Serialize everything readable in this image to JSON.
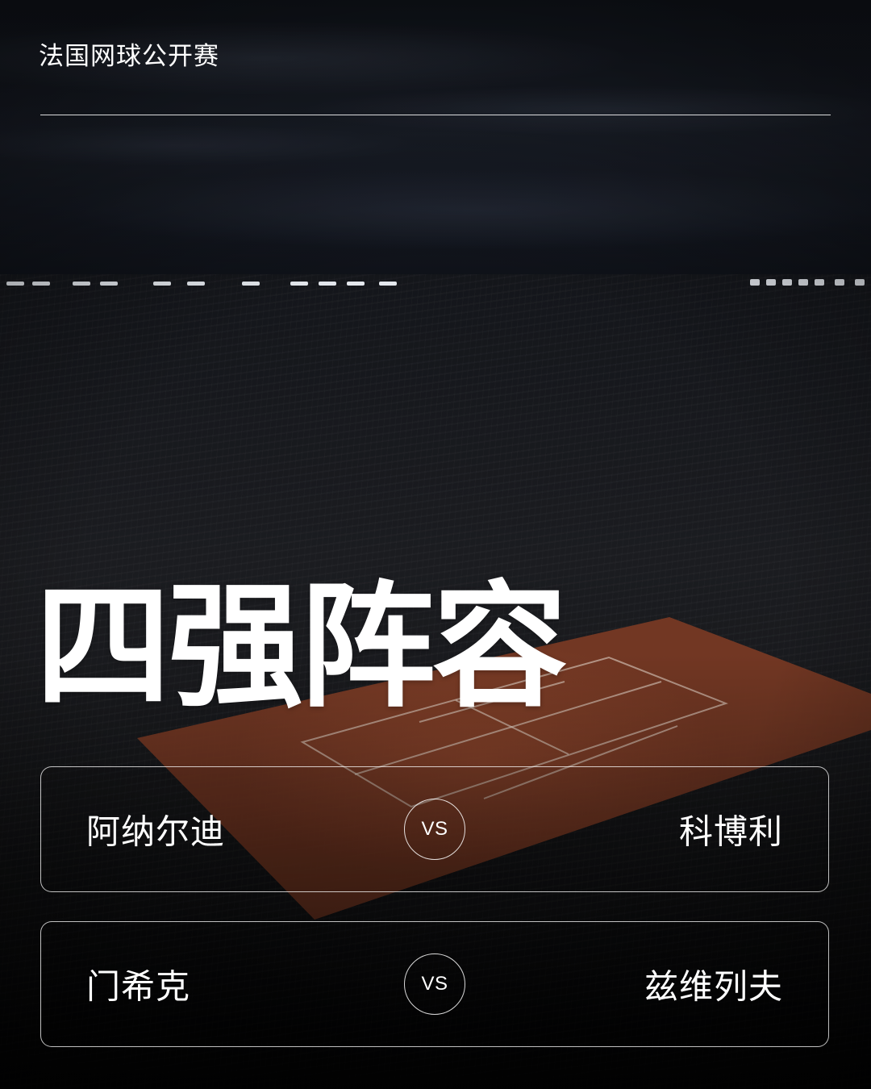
{
  "event": {
    "title": "法国网球公开赛"
  },
  "headline": "四强阵容",
  "matches": [
    {
      "player_left": "阿纳尔迪",
      "vs_label": "VS",
      "player_right": "科博利"
    },
    {
      "player_left": "门希克",
      "vs_label": "VS",
      "player_right": "兹维列夫"
    }
  ],
  "colors": {
    "court_clay": "#7a3a24",
    "text": "#ffffff",
    "background": "#05070b"
  }
}
